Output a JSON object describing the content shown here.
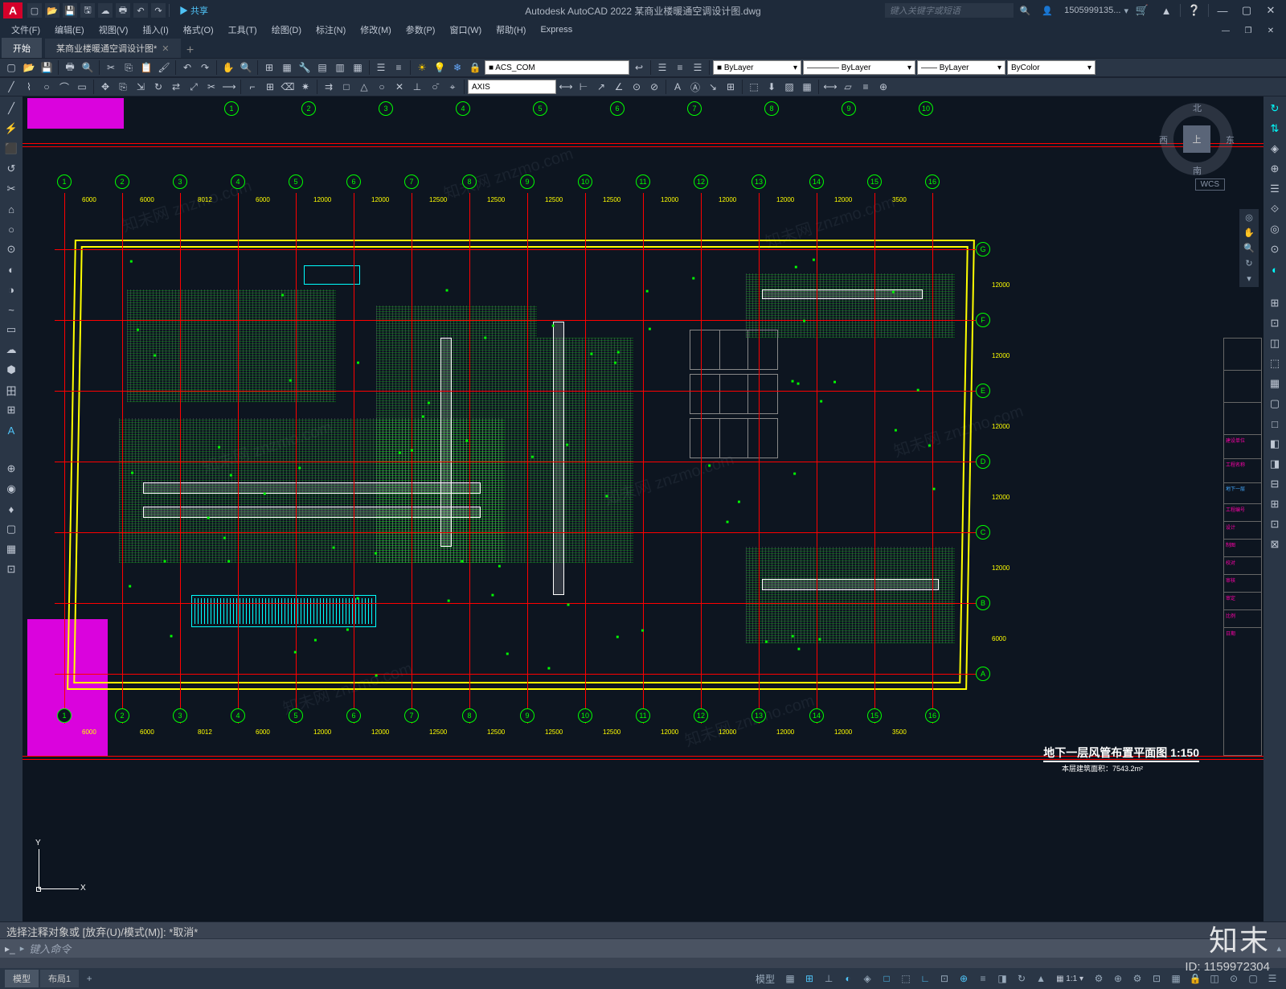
{
  "app": {
    "title": "Autodesk AutoCAD 2022    某商业楼暖通空调设计图.dwg"
  },
  "titlebar": {
    "logo": "A",
    "share": "▶ 共享",
    "search_placeholder": "键入关键字或短语",
    "user_icon": "👤",
    "user": "1505999135...",
    "icons": {
      "cart": "🛒",
      "help": "❔",
      "app": "▲"
    }
  },
  "menus": [
    "文件(F)",
    "编辑(E)",
    "视图(V)",
    "插入(I)",
    "格式(O)",
    "工具(T)",
    "绘图(D)",
    "标注(N)",
    "修改(M)",
    "参数(P)",
    "窗口(W)",
    "帮助(H)",
    "Express"
  ],
  "ribbon": {
    "tabs": [
      "开始"
    ],
    "doc_tab": "某商业楼暖通空调设计图*",
    "add": "+"
  },
  "toolbar": {
    "layer_current": "■ ACS_COM",
    "prop_color": "■ ByLayer",
    "prop_line1": "———— ByLayer",
    "prop_line2": "—— ByLayer",
    "prop_color2": "ByColor",
    "axis": "AXIS",
    "sun": "☀"
  },
  "viewcube": {
    "face": "上",
    "n": "北",
    "s": "南",
    "e": "东",
    "w": "西",
    "wcs": "WCS"
  },
  "ucs": {
    "x": "X",
    "y": "Y"
  },
  "drawing": {
    "grid_cols": [
      "1",
      "2",
      "3",
      "4",
      "5",
      "6",
      "7",
      "8",
      "9",
      "10",
      "11",
      "12",
      "13",
      "14",
      "15",
      "16"
    ],
    "grid_rows": [
      "A",
      "B",
      "C",
      "D",
      "E",
      "F",
      "G"
    ],
    "dims_top": [
      "6000",
      "6000",
      "8012",
      "6000",
      "12000",
      "12000",
      "12500",
      "12500",
      "12500",
      "12500",
      "12000",
      "12000",
      "12000",
      "12000",
      "3500"
    ],
    "dims_bottom": [
      "6000",
      "6000",
      "8012",
      "6000",
      "12000",
      "12000",
      "12500",
      "12500",
      "12500",
      "12500",
      "12000",
      "12000",
      "12000",
      "12000",
      "3500"
    ],
    "dims_right": [
      "6000",
      "12000",
      "12000",
      "12000",
      "12000",
      "12000"
    ],
    "title": "地下一层风管布置平面图  1:150",
    "subtitle": "本层建筑面积：7543.2m²"
  },
  "command": {
    "history": "选择注释对象或  [放弃(U)/模式(M)]:  *取消*",
    "prompt_icon": "▸_",
    "placeholder": "键入命令"
  },
  "status": {
    "tabs": [
      "模型",
      "布局1"
    ],
    "add": "+",
    "model_btn": "模型",
    "scale": "▦ 1:1 ▾",
    "gear": "⚙"
  },
  "watermark": {
    "brand": "知末",
    "id": "ID: 1159972304",
    "repeat": "知未网 znzmo.com"
  },
  "tool_icons": {
    "left": [
      "╱",
      "⚡",
      "⬛",
      "↺",
      "✂",
      "⌂",
      "○",
      "⊙",
      "◐",
      "◑",
      "~",
      "▭",
      "☁",
      "⬢",
      "田",
      "⊞",
      "A"
    ],
    "left2": [
      "⊕",
      "◉",
      "♦",
      "▢",
      "▦",
      "⊡"
    ],
    "right": [
      "⊞",
      "⊡",
      "◫",
      "⬚",
      "▦",
      "▢",
      "□",
      "◧",
      "◨",
      "⊟",
      "⊞",
      "⊡",
      "⊠"
    ],
    "right2": [
      "↻",
      "⇅",
      "◈",
      "⊕",
      "☰",
      "⟐",
      "◎",
      "⊙",
      "◐"
    ]
  }
}
